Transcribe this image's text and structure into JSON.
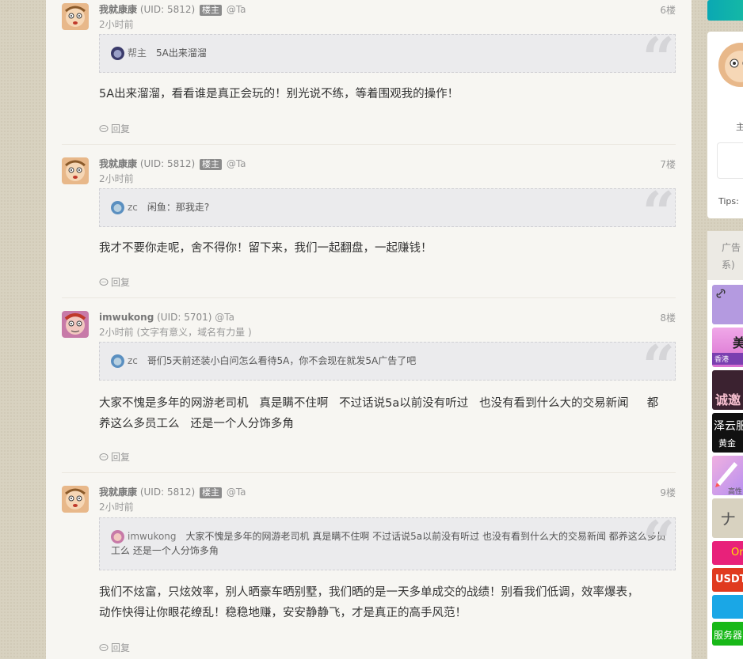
{
  "posts": [
    {
      "username": "我就康康",
      "uid": "(UID: 5812)",
      "badge": "楼主",
      "at": "@Ta",
      "floor": "6楼",
      "time": "2小时前",
      "quote_user": "帮主",
      "quote_text": "5A出来溜溜",
      "content": "5A出来溜溜，看看谁是真正会玩的！别光说不练，等着围观我的操作！",
      "reply": "回复"
    },
    {
      "username": "我就康康",
      "uid": "(UID: 5812)",
      "badge": "楼主",
      "at": "@Ta",
      "floor": "7楼",
      "time": "2小时前",
      "quote_user": "zc",
      "quote_text": "闲鱼：那我走?",
      "content": "我才不要你走呢，舍不得你！留下来，我们一起翻盘，一起赚钱！",
      "reply": "回复"
    },
    {
      "username": "imwukong",
      "uid": "(UID: 5701)",
      "at": "@Ta",
      "floor": "8楼",
      "time": "2小时前 (文字有意义，域名有力量 )",
      "quote_user": "zc",
      "quote_text": "哥们5天前还装小白问怎么看待5A，你不会现在就发5A广告了吧",
      "content_line1": "大家不愧是多年的网游老司机   真是瞒不住啊   不过话说5a以前没有听过   也没有看到什么大的交易新闻     都",
      "content_line2": "养这么多员工么   还是一个人分饰多角",
      "reply": "回复"
    },
    {
      "username": "我就康康",
      "uid": "(UID: 5812)",
      "badge": "楼主",
      "at": "@Ta",
      "floor": "9楼",
      "time": "2小时前",
      "quote_user": "imwukong",
      "quote_text_line1": "大家不愧是多年的网游老司机 真是瞒不住啊 不过话说5a以前没有听过 也没有看到什么大的交易新闻 都养这么多员",
      "quote_text_line2": "工么 还是一个人分饰多角",
      "content_line1": "我们不炫富，只炫效率，别人晒豪车晒别墅，我们晒的是一天多单成交的战绩！别看我们低调，效率爆表，",
      "content_line2": "动作快得让你眼花缭乱！稳稳地赚，安安静静飞，才是真正的高手风范！",
      "reply": "回复"
    }
  ],
  "sidebar": {
    "card_text": "主",
    "tips": "Tips:",
    "ads_title_1": "广告",
    "ads_title_2": "系)",
    "ads": [
      {
        "text": "",
        "color": "#b49ae0"
      },
      {
        "text": "美",
        "color": "#e879c9"
      },
      {
        "text": "诚邀",
        "color": "#3b2230"
      },
      {
        "text": "泽云服",
        "color": "#111111"
      },
      {
        "text": "",
        "color": "#e0a0d8"
      },
      {
        "text": "ナ",
        "color": "#d8d2c0"
      },
      {
        "text": "On",
        "color": "#e8217a"
      },
      {
        "text": "USDT",
        "color": "#e03a1e"
      },
      {
        "text": "",
        "color": "#1aa7e6"
      },
      {
        "text": "服务器",
        "color": "#18b818"
      }
    ],
    "ad_sub_texts": [
      "香港",
      "黄金",
      "高性"
    ]
  }
}
